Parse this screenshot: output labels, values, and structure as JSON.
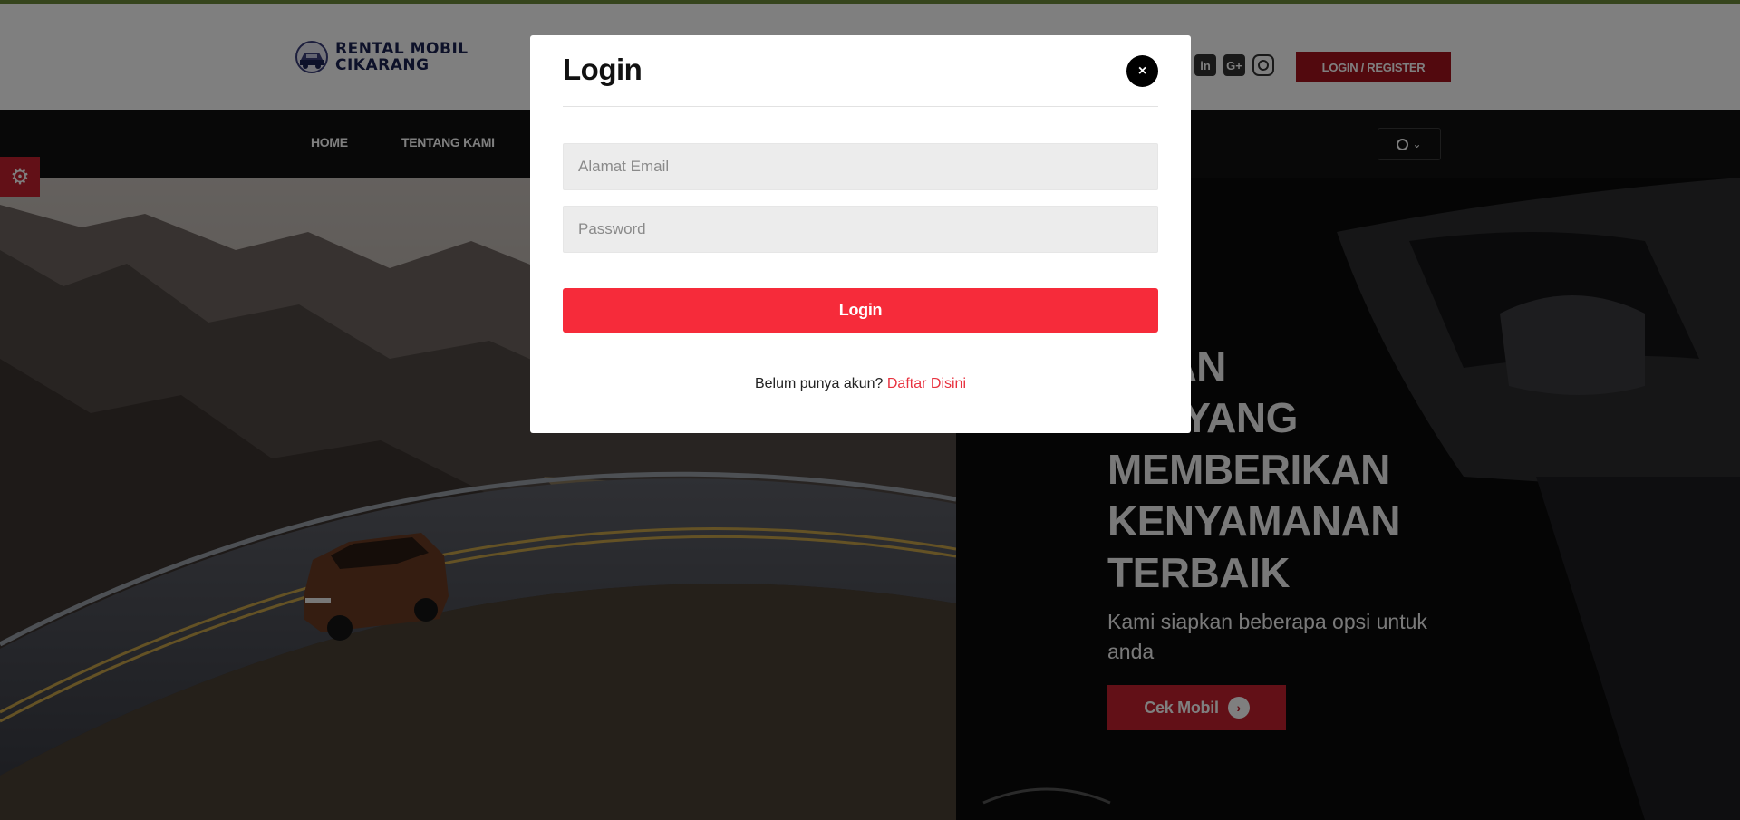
{
  "header": {
    "logo_line1": "RENTAL MOBIL",
    "logo_line2": "CIKARANG",
    "socials": [
      {
        "name": "linkedin-icon",
        "glyph": "in"
      },
      {
        "name": "google-plus-icon",
        "glyph": "G+"
      },
      {
        "name": "instagram-icon",
        "glyph": ""
      }
    ],
    "login_register_label": "LOGIN / REGISTER",
    "accent_color": "#a4121c",
    "top_border_color": "#6c8a3a"
  },
  "nav": {
    "items": [
      {
        "label": "HOME"
      },
      {
        "label": "TENTANG KAMI"
      }
    ],
    "user_menu_icon": "user-circle-icon",
    "user_menu_chevron": "chevron-down-icon"
  },
  "hero": {
    "title_lines": [
      "UKAN",
      "BIL YANG",
      "MEMBERIKAN",
      "KENYAMANAN",
      "TERBAIK"
    ],
    "subtitle": "Kami siapkan beberapa opsi untuk anda",
    "cta_label": "Cek Mobil",
    "cta_color": "#c5202e"
  },
  "side_tab": {
    "icon": "gear-icon"
  },
  "modal": {
    "title": "Login",
    "close_label": "×",
    "email_placeholder": "Alamat Email",
    "password_placeholder": "Password",
    "submit_label": "Login",
    "submit_color": "#f62b3a",
    "signup_prompt": "Belum punya akun?",
    "signup_link": "Daftar Disini"
  }
}
